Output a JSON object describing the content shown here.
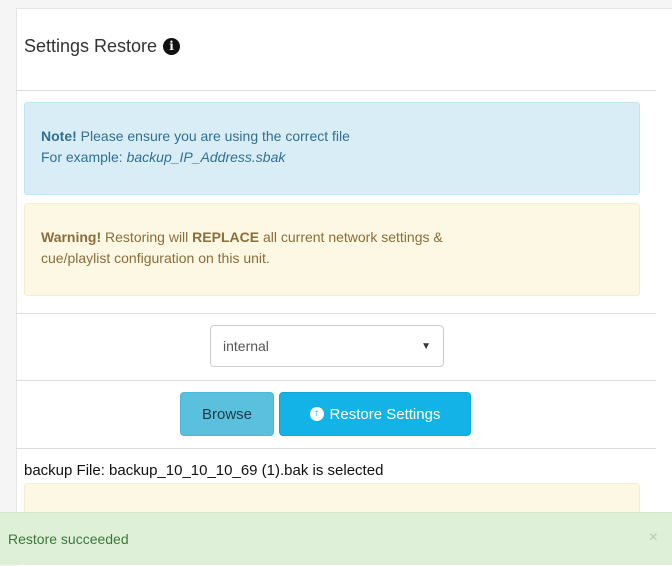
{
  "panel": {
    "title": "Settings Restore",
    "info_icon": "info-circle-icon"
  },
  "alert_info": {
    "lead": "Note!",
    "text1": " Please ensure you are using the correct file",
    "example_label": "For example: ",
    "example_value": "backup_IP_Address.sbak"
  },
  "alert_warning": {
    "lead": "Warning!",
    "text1": " Restoring will ",
    "emphasis": "REPLACE",
    "text2": " all current network settings &",
    "text3": "cue/playlist configuration on this unit."
  },
  "source_select": {
    "value": "internal"
  },
  "buttons": {
    "browse_label": "Browse",
    "restore_label": "Restore Settings",
    "restore_icon": "arrow-circle-up-icon"
  },
  "file_status": "backup File: backup_10_10_10_69 (1).bak is selected",
  "toast": {
    "message": "Restore succeeded",
    "close": "×"
  },
  "colors": {
    "info_bg": "#d9edf7",
    "warning_bg": "#fcf8e3",
    "success_bg": "#dff0d8",
    "primary": "#14b3e7",
    "browse": "#5bc0de"
  }
}
